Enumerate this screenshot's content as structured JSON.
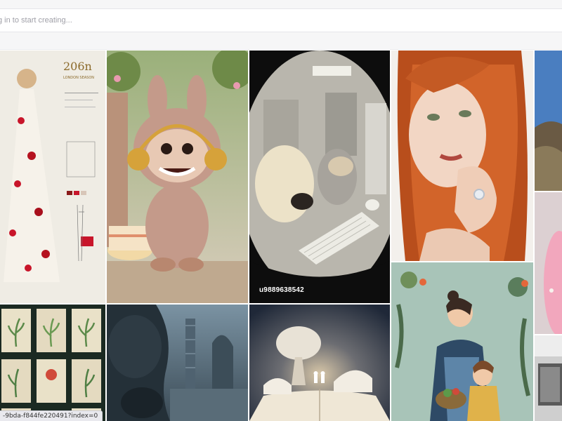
{
  "prompt": {
    "placeholder": "g in to start creating..."
  },
  "poster": {
    "title": "206n",
    "subtitle": "LONDON SEASON"
  },
  "tiles": [
    {
      "name": "gallery-image-fashion-dress",
      "colors": [
        "#efece4",
        "#c8152a"
      ]
    },
    {
      "name": "gallery-image-bunny-creature",
      "colors": [
        "#b99a82",
        "#6b7d4a"
      ]
    },
    {
      "name": "gallery-image-dog-cat-computer",
      "colors": [
        "#2a2a2a",
        "#cfc8b8"
      ]
    },
    {
      "name": "gallery-image-redhead-portrait",
      "colors": [
        "#c45a24",
        "#f2dccb"
      ]
    },
    {
      "name": "gallery-image-landscape",
      "colors": [
        "#3d6fb0",
        "#7a6a4f"
      ]
    },
    {
      "name": "gallery-image-botanical-stamps",
      "colors": [
        "#1b2a22",
        "#8aa48a"
      ]
    },
    {
      "name": "gallery-image-gasmask-tower",
      "colors": [
        "#5e7484",
        "#243038"
      ]
    },
    {
      "name": "gallery-image-astronauts-book",
      "colors": [
        "#2c3a52",
        "#e6d9c2"
      ]
    },
    {
      "name": "gallery-image-mother-child-illustration",
      "colors": [
        "#a8c4b8",
        "#3a5a6a"
      ]
    },
    {
      "name": "gallery-image-pink-fluffy",
      "colors": [
        "#d9c7c9",
        "#f4a6be"
      ]
    },
    {
      "name": "gallery-image-interior",
      "colors": [
        "#c9c9c9",
        "#4d4d4d"
      ]
    }
  ],
  "image_label": "u9889638542",
  "status_bar": {
    "url": "-9bda-f844fe220491?index=0"
  }
}
